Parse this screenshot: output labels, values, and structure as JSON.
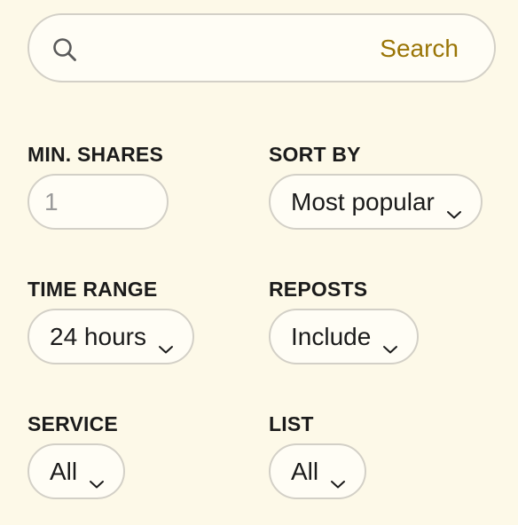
{
  "search": {
    "placeholder": "",
    "button_label": "Search"
  },
  "filters": {
    "min_shares": {
      "label": "MIN. SHARES",
      "placeholder": "1"
    },
    "sort_by": {
      "label": "SORT BY",
      "value": "Most popular"
    },
    "time_range": {
      "label": "TIME RANGE",
      "value": "24 hours"
    },
    "reposts": {
      "label": "REPOSTS",
      "value": "Include"
    },
    "service": {
      "label": "SERVICE",
      "value": "All"
    },
    "list": {
      "label": "LIST",
      "value": "All"
    }
  },
  "icons": {
    "search": "search-icon",
    "dropdown": "chevron-down-icon"
  },
  "colors": {
    "background": "#fdf9e8",
    "accent": "#9a7506",
    "border": "#d3d0c7",
    "field_bg": "#fffdf5"
  }
}
